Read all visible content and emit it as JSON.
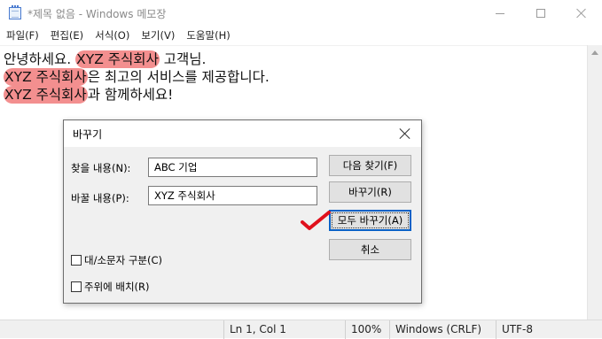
{
  "window": {
    "title": "*제목 없음 - Windows 메모장"
  },
  "menu": {
    "items": [
      "파일(F)",
      "편집(E)",
      "서식(O)",
      "보기(V)",
      "도움말(H)"
    ]
  },
  "editor": {
    "line1": {
      "before": "안녕하세요. ",
      "highlight": "XYZ 주식회사",
      "after": " 고객님."
    },
    "line2": {
      "highlight": "XYZ 주식회사",
      "after": "은 최고의 서비스를 제공합니다."
    },
    "line3": {
      "highlight": "XYZ 주식회사",
      "after": "과 함께하세요!"
    }
  },
  "status": {
    "position": "Ln 1, Col 1",
    "zoom": "100%",
    "line_ending": "Windows (CRLF)",
    "encoding": "UTF-8"
  },
  "dialog": {
    "title": "바꾸기",
    "find_label": "찾을 내용(N):",
    "find_value": "ABC 기업",
    "replace_label": "바꿀 내용(P):",
    "replace_value": "XYZ 주식회사",
    "btn_find_next": "다음 찾기(F)",
    "btn_replace": "바꾸기(R)",
    "btn_replace_all": "모두 바꾸기(A)",
    "btn_cancel": "취소",
    "chk_match_case": "대/소문자 구분(C)",
    "chk_wrap": "주위에 배치(R)"
  },
  "colors": {
    "highlight": "#ef7070",
    "annotation": "#e0101c",
    "focus": "#0a62c7"
  },
  "icons": {
    "app": "notepad-icon",
    "annotation": "red-checkmark"
  }
}
